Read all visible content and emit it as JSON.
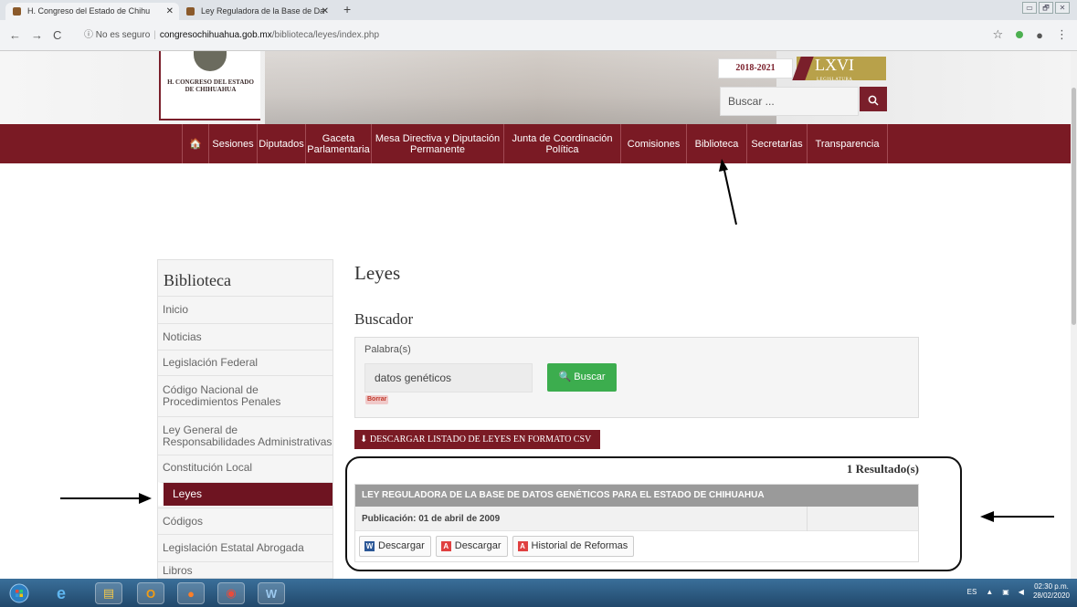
{
  "browser": {
    "tabs": [
      {
        "title": "H. Congreso del Estado de Chihu",
        "close": "✕"
      },
      {
        "title": "Ley Reguladora de la Base de Da",
        "close": "✕"
      }
    ],
    "new_tab": "+",
    "window_controls": [
      "▭",
      "🗗",
      "✕"
    ],
    "url_security": "ⓘ No es seguro",
    "url_domain": "congresochihuahua.gob.mx",
    "url_path": "/biblioteca/leyes/index.php"
  },
  "header": {
    "logo_text": "H. CONGRESO DEL ESTADO DE CHIHUAHUA",
    "period": "2018-2021",
    "legislature": "LXVI",
    "legislature_sub": "LEGISLATURA",
    "search_placeholder": "Buscar ..."
  },
  "nav": [
    {
      "label": "Sesiones"
    },
    {
      "label": "Diputados"
    },
    {
      "label": "Gaceta Parlamentaria"
    },
    {
      "label": "Mesa Directiva y Diputación Permanente"
    },
    {
      "label": "Junta de Coordinación Política"
    },
    {
      "label": "Comisiones"
    },
    {
      "label": "Biblioteca"
    },
    {
      "label": "Secretarías"
    },
    {
      "label": "Transparencia"
    }
  ],
  "sidebar": {
    "title": "Biblioteca",
    "items": [
      {
        "label": "Inicio"
      },
      {
        "label": "Noticias"
      },
      {
        "label": "Legislación Federal"
      },
      {
        "label": "Código Nacional de Procedimientos Penales"
      },
      {
        "label": "Ley General de Responsabilidades Administrativas"
      },
      {
        "label": "Constitución Local"
      },
      {
        "label": "Leyes"
      },
      {
        "label": "Códigos"
      },
      {
        "label": "Legislación Estatal Abrogada"
      },
      {
        "label": "Libros"
      }
    ]
  },
  "content": {
    "title": "Leyes",
    "subtitle": "Buscador",
    "field_label": "Palabra(s)",
    "field_value": "datos genéticos",
    "search_button": "Buscar",
    "clear_label": "Borrar",
    "csv_button": "DESCARGAR LISTADO DE LEYES EN FORMATO CSV",
    "result_count": "1 Resultado(s)",
    "result_title": "LEY REGULADORA DE LA BASE DE DATOS GENÉTICOS PARA EL ESTADO DE CHIHUAHUA",
    "result_pub": "Publicación: 01 de abril de 2009",
    "buttons": [
      {
        "label": "Descargar",
        "icon": "W"
      },
      {
        "label": "Descargar",
        "icon": "PDF"
      },
      {
        "label": "Historial de Reformas",
        "icon": "PDF"
      }
    ]
  },
  "taskbar": {
    "lang": "ES",
    "time": "02:30 p.m.",
    "date": "28/02/2020"
  }
}
